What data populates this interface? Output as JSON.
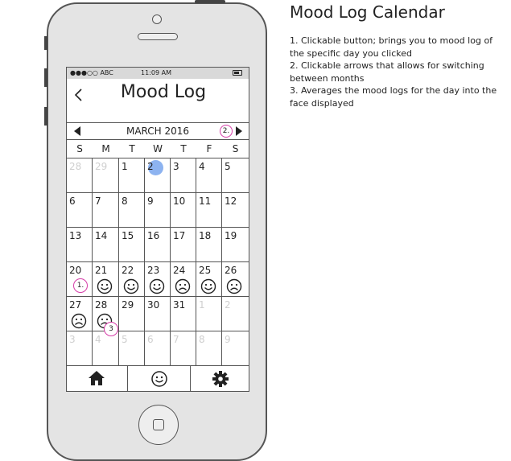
{
  "status_bar": {
    "carrier": "●●●○○ ABC",
    "time": "11:09 AM",
    "battery_icon": "battery-icon"
  },
  "header": {
    "back_label": "<",
    "title": "Mood Log"
  },
  "calendar": {
    "month_label": "MARCH 2016",
    "weekdays": [
      "S",
      "M",
      "T",
      "W",
      "T",
      "F",
      "S"
    ],
    "weeks": [
      [
        {
          "day": "28",
          "dim": true
        },
        {
          "day": "29",
          "dim": true
        },
        {
          "day": "1"
        },
        {
          "day": "2",
          "today": true
        },
        {
          "day": "3"
        },
        {
          "day": "4"
        },
        {
          "day": "5"
        }
      ],
      [
        {
          "day": "6"
        },
        {
          "day": "7"
        },
        {
          "day": "8"
        },
        {
          "day": "9"
        },
        {
          "day": "10"
        },
        {
          "day": "11"
        },
        {
          "day": "12"
        }
      ],
      [
        {
          "day": "13"
        },
        {
          "day": "14"
        },
        {
          "day": "15"
        },
        {
          "day": "16"
        },
        {
          "day": "17"
        },
        {
          "day": "18"
        },
        {
          "day": "19"
        }
      ],
      [
        {
          "day": "20"
        },
        {
          "day": "21",
          "mood": "smile"
        },
        {
          "day": "22",
          "mood": "smile"
        },
        {
          "day": "23",
          "mood": "smile"
        },
        {
          "day": "24",
          "mood": "frown"
        },
        {
          "day": "25",
          "mood": "smile"
        },
        {
          "day": "26",
          "mood": "frown"
        }
      ],
      [
        {
          "day": "27",
          "mood": "frown"
        },
        {
          "day": "28",
          "mood": "frown"
        },
        {
          "day": "29"
        },
        {
          "day": "30"
        },
        {
          "day": "31"
        },
        {
          "day": "1",
          "dim": true
        },
        {
          "day": "2",
          "dim": true
        }
      ],
      [
        {
          "day": "3",
          "dim": true
        },
        {
          "day": "4",
          "dim": true
        },
        {
          "day": "5",
          "dim": true
        },
        {
          "day": "6",
          "dim": true
        },
        {
          "day": "7",
          "dim": true
        },
        {
          "day": "8",
          "dim": true
        },
        {
          "day": "9",
          "dim": true
        }
      ]
    ],
    "today_highlight_color": "#8db3f0"
  },
  "callouts": {
    "one": "1.",
    "two": "2.",
    "three": "3"
  },
  "tabbar": {
    "tabs": [
      "home-icon",
      "smiley-icon",
      "gear-icon"
    ]
  },
  "notes": {
    "title": "Mood Log Calendar",
    "items": [
      "1. Clickable button; brings you to mood log of the specific day you clicked",
      "2. Clickable arrows that allows for switching between months",
      "3. Averages the mood logs for the day into the face displayed"
    ]
  },
  "colors": {
    "annotation": "#d63ca8",
    "frame": "#555555",
    "phone_body": "#e4e4e4"
  }
}
